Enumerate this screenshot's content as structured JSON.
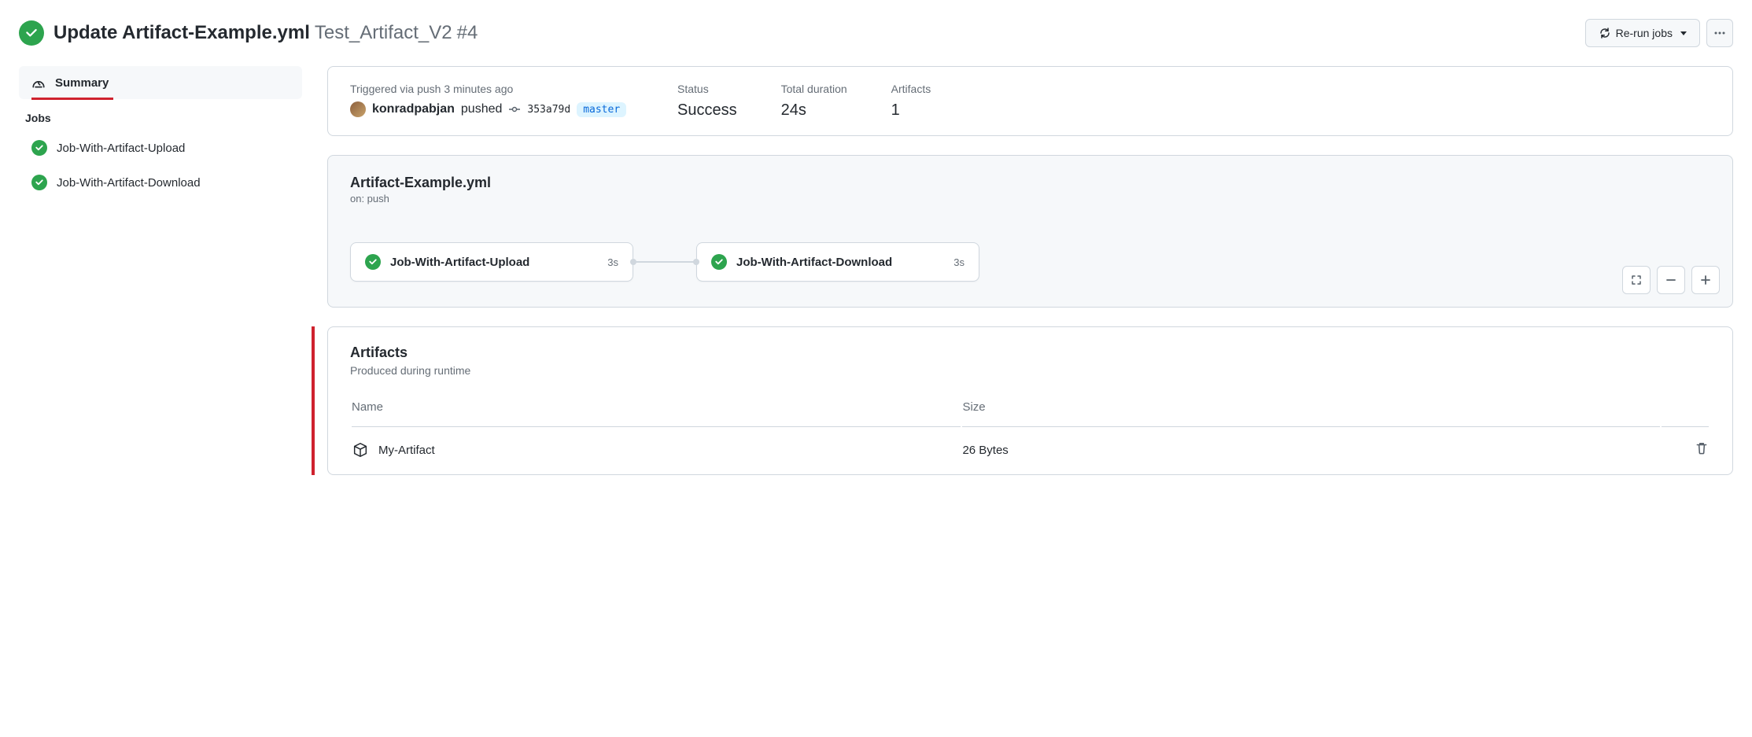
{
  "header": {
    "workflow_name": "Update Artifact-Example.yml",
    "run_name": "Test_Artifact_V2",
    "run_number": "#4",
    "rerun_label": "Re-run jobs"
  },
  "sidebar": {
    "summary_label": "Summary",
    "jobs_heading": "Jobs",
    "jobs": [
      {
        "name": "Job-With-Artifact-Upload"
      },
      {
        "name": "Job-With-Artifact-Download"
      }
    ]
  },
  "summary": {
    "triggered_label": "Triggered via push 3 minutes ago",
    "actor": "konradpabjan",
    "action_verb": "pushed",
    "commit_sha": "353a79d",
    "branch": "master",
    "status_label": "Status",
    "status_value": "Success",
    "duration_label": "Total duration",
    "duration_value": "24s",
    "artifacts_label": "Artifacts",
    "artifacts_value": "1"
  },
  "workflow": {
    "file_name": "Artifact-Example.yml",
    "trigger_text": "on: push",
    "nodes": [
      {
        "name": "Job-With-Artifact-Upload",
        "duration": "3s"
      },
      {
        "name": "Job-With-Artifact-Download",
        "duration": "3s"
      }
    ]
  },
  "artifacts": {
    "title": "Artifacts",
    "subtitle": "Produced during runtime",
    "col_name": "Name",
    "col_size": "Size",
    "rows": [
      {
        "name": "My-Artifact",
        "size": "26 Bytes"
      }
    ]
  }
}
